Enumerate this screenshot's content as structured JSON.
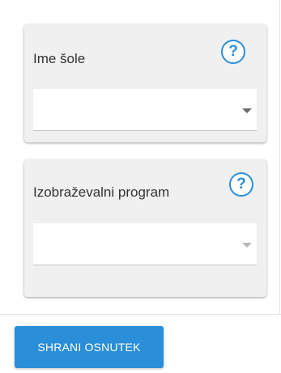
{
  "form": {
    "school_field": {
      "label": "Ime šole",
      "help_icon": "question-circle-icon",
      "selected_value": ""
    },
    "program_field": {
      "label": "Izobraževalni program",
      "help_icon": "question-circle-icon",
      "selected_value": ""
    },
    "help_glyph": "?"
  },
  "footer": {
    "save_draft_label": "SHRANI OSNUTEK"
  },
  "colors": {
    "accent": "#2a8ed8",
    "card_background": "#f0f0f0",
    "text": "#333333"
  }
}
